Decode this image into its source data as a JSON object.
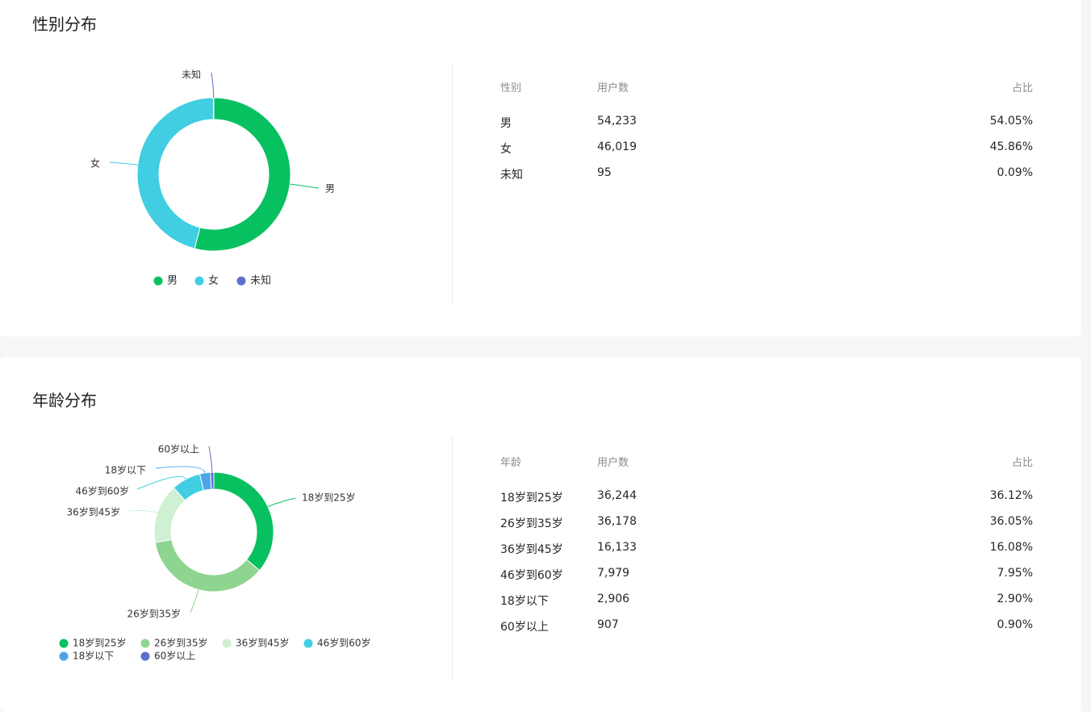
{
  "gender": {
    "title": "性别分布",
    "table": {
      "headers": [
        "性别",
        "用户数",
        "占比"
      ],
      "rows": [
        [
          "男",
          "54,233",
          "54.05%"
        ],
        [
          "女",
          "46,019",
          "45.86%"
        ],
        [
          "未知",
          "95",
          "0.09%"
        ]
      ]
    }
  },
  "age": {
    "title": "年龄分布",
    "table": {
      "headers": [
        "年龄",
        "用户数",
        "占比"
      ],
      "rows": [
        [
          "18岁到25岁",
          "36,244",
          "36.12%"
        ],
        [
          "26岁到35岁",
          "36,178",
          "36.05%"
        ],
        [
          "36岁到45岁",
          "16,133",
          "16.08%"
        ],
        [
          "46岁到60岁",
          "7,979",
          "7.95%"
        ],
        [
          "18岁以下",
          "2,906",
          "2.90%"
        ],
        [
          "60岁以上",
          "907",
          "0.90%"
        ]
      ]
    }
  },
  "chart_data": [
    {
      "type": "pie",
      "variant": "donut",
      "title": "性别分布",
      "categories": [
        "男",
        "女",
        "未知"
      ],
      "values": [
        54233,
        46019,
        95
      ],
      "colors": [
        "#07c160",
        "#41cde2",
        "#5b6fcf"
      ],
      "legend": "bottom"
    },
    {
      "type": "pie",
      "variant": "donut",
      "title": "年龄分布",
      "categories": [
        "18岁到25岁",
        "26岁到35岁",
        "36岁到45岁",
        "46岁到60岁",
        "18岁以下",
        "60岁以上"
      ],
      "values": [
        36244,
        36178,
        16133,
        7979,
        2906,
        907
      ],
      "colors": [
        "#07c160",
        "#8ed58f",
        "#cff0d3",
        "#41cde2",
        "#4fa3e8",
        "#5b6fcf"
      ],
      "legend": "bottom"
    }
  ]
}
